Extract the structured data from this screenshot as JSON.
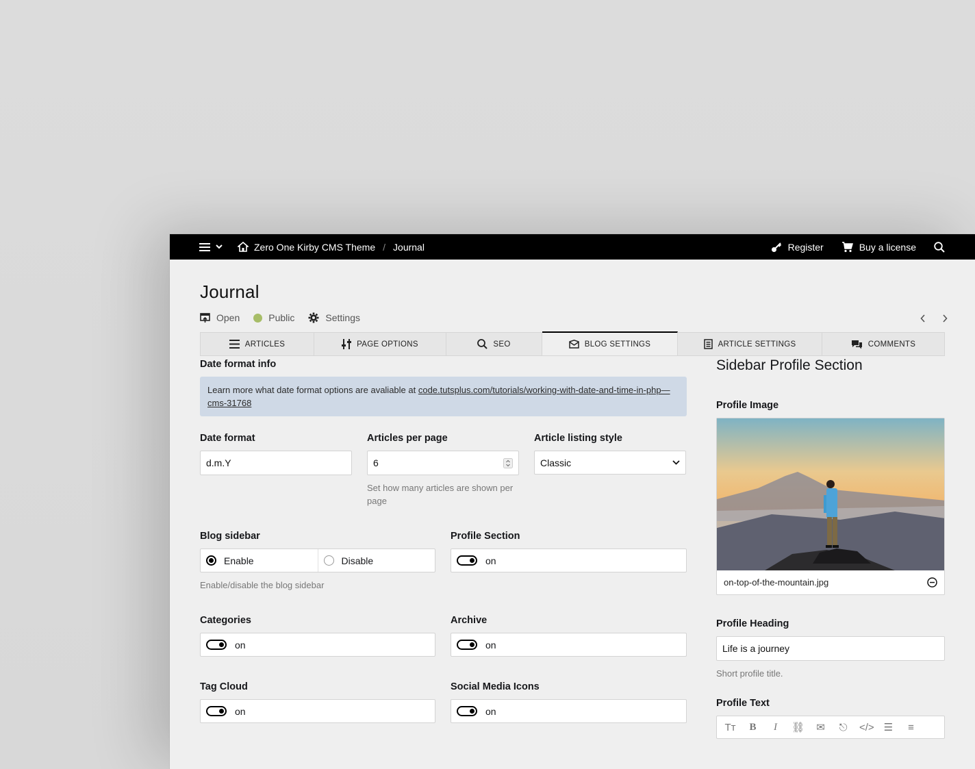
{
  "topbar": {
    "site_name": "Zero One Kirby CMS Theme",
    "separator": "/",
    "current_page": "Journal",
    "register_label": "Register",
    "license_label": "Buy a license"
  },
  "header": {
    "title": "Journal",
    "open_label": "Open",
    "status_label": "Public",
    "settings_label": "Settings",
    "status_color": "#a7bd68"
  },
  "tabs": [
    {
      "label": "ARTICLES",
      "icon": "list-icon"
    },
    {
      "label": "PAGE OPTIONS",
      "icon": "sliders-icon"
    },
    {
      "label": "SEO",
      "icon": "search-icon"
    },
    {
      "label": "BLOG SETTINGS",
      "icon": "envelope-icon",
      "active": true
    },
    {
      "label": "ARTICLE SETTINGS",
      "icon": "document-icon"
    },
    {
      "label": "COMMENTS",
      "icon": "chat-icon"
    }
  ],
  "main": {
    "date_info_label": "Date format info",
    "date_info_text": "Learn more what date format options are avaliable at ",
    "date_info_link": "code.tutsplus.com/tutorials/working-with-date-and-time-in-php—cms-31768",
    "date_format_label": "Date format",
    "date_format_value": "d.m.Y",
    "articles_per_page_label": "Articles per page",
    "articles_per_page_value": "6",
    "articles_per_page_help": "Set how many articles are shown per page",
    "listing_style_label": "Article listing style",
    "listing_style_value": "Classic",
    "blog_sidebar_label": "Blog sidebar",
    "blog_sidebar_enable": "Enable",
    "blog_sidebar_disable": "Disable",
    "blog_sidebar_help": "Enable/disable the blog sidebar",
    "profile_section_label": "Profile Section",
    "profile_section_value": "on",
    "categories_label": "Categories",
    "categories_value": "on",
    "archive_label": "Archive",
    "archive_value": "on",
    "tag_cloud_label": "Tag Cloud",
    "tag_cloud_value": "on",
    "social_icons_label": "Social Media Icons",
    "social_icons_value": "on"
  },
  "sidebar": {
    "title": "Sidebar Profile Section",
    "profile_image_label": "Profile Image",
    "profile_image_filename": "on-top-of-the-mountain.jpg",
    "profile_heading_label": "Profile Heading",
    "profile_heading_value": "Life is a journey",
    "profile_heading_help": "Short profile title.",
    "profile_text_label": "Profile Text"
  }
}
